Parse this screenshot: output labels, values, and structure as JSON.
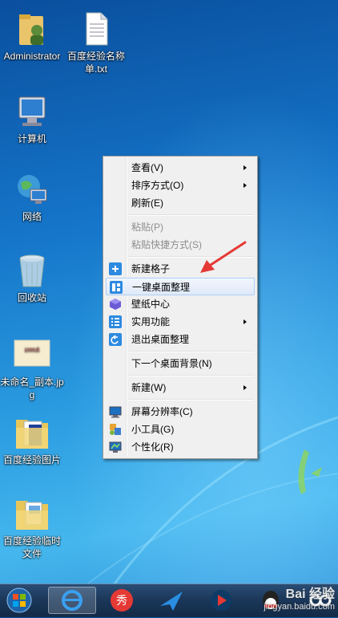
{
  "desktop": {
    "icons": [
      {
        "label": "Administrator",
        "icon": "user-folder-icon"
      },
      {
        "label": "百度经验名称单.txt",
        "icon": "text-file-icon"
      },
      {
        "label": "计算机",
        "icon": "computer-icon"
      },
      {
        "label": "网络",
        "icon": "network-icon"
      },
      {
        "label": "回收站",
        "icon": "recycle-bin-icon"
      },
      {
        "label": "未命名_副本.jpg",
        "icon": "image-file-icon"
      },
      {
        "label": "百度经验图片",
        "icon": "folder-icon"
      },
      {
        "label": "百度经验临时文件",
        "icon": "folder-icon"
      }
    ]
  },
  "context_menu": {
    "items": [
      {
        "label": "查看(V)",
        "submenu": true
      },
      {
        "label": "排序方式(O)",
        "submenu": true
      },
      {
        "label": "刷新(E)"
      },
      {
        "label": "粘贴(P)",
        "disabled": true
      },
      {
        "label": "粘贴快捷方式(S)",
        "disabled": true
      },
      {
        "label": "新建格子",
        "icon": "plus-icon"
      },
      {
        "label": "一键桌面整理",
        "icon": "layout-icon",
        "highlighted": true
      },
      {
        "label": "壁纸中心",
        "icon": "cube-icon"
      },
      {
        "label": "实用功能",
        "icon": "list-icon",
        "submenu": true
      },
      {
        "label": "退出桌面整理",
        "icon": "exit-icon"
      },
      {
        "label": "下一个桌面背景(N)"
      },
      {
        "label": "新建(W)",
        "submenu": true
      },
      {
        "label": "屏幕分辨率(C)",
        "icon": "monitor-icon"
      },
      {
        "label": "小工具(G)",
        "icon": "gadgets-icon"
      },
      {
        "label": "个性化(R)",
        "icon": "personalize-icon"
      }
    ]
  },
  "taskbar": {
    "buttons": [
      "start-orb-icon",
      "ie-icon",
      "360-icon",
      "feiniu-icon",
      "video-player-icon",
      "qq-icon",
      "cloud-icon"
    ]
  },
  "watermark": {
    "line1": "Bai 经验",
    "line2": "jingyan.baidu.com"
  },
  "colors": {
    "accent": "#1575c9",
    "menu_bg": "#f0f0f0",
    "highlight": "#aecff7"
  }
}
